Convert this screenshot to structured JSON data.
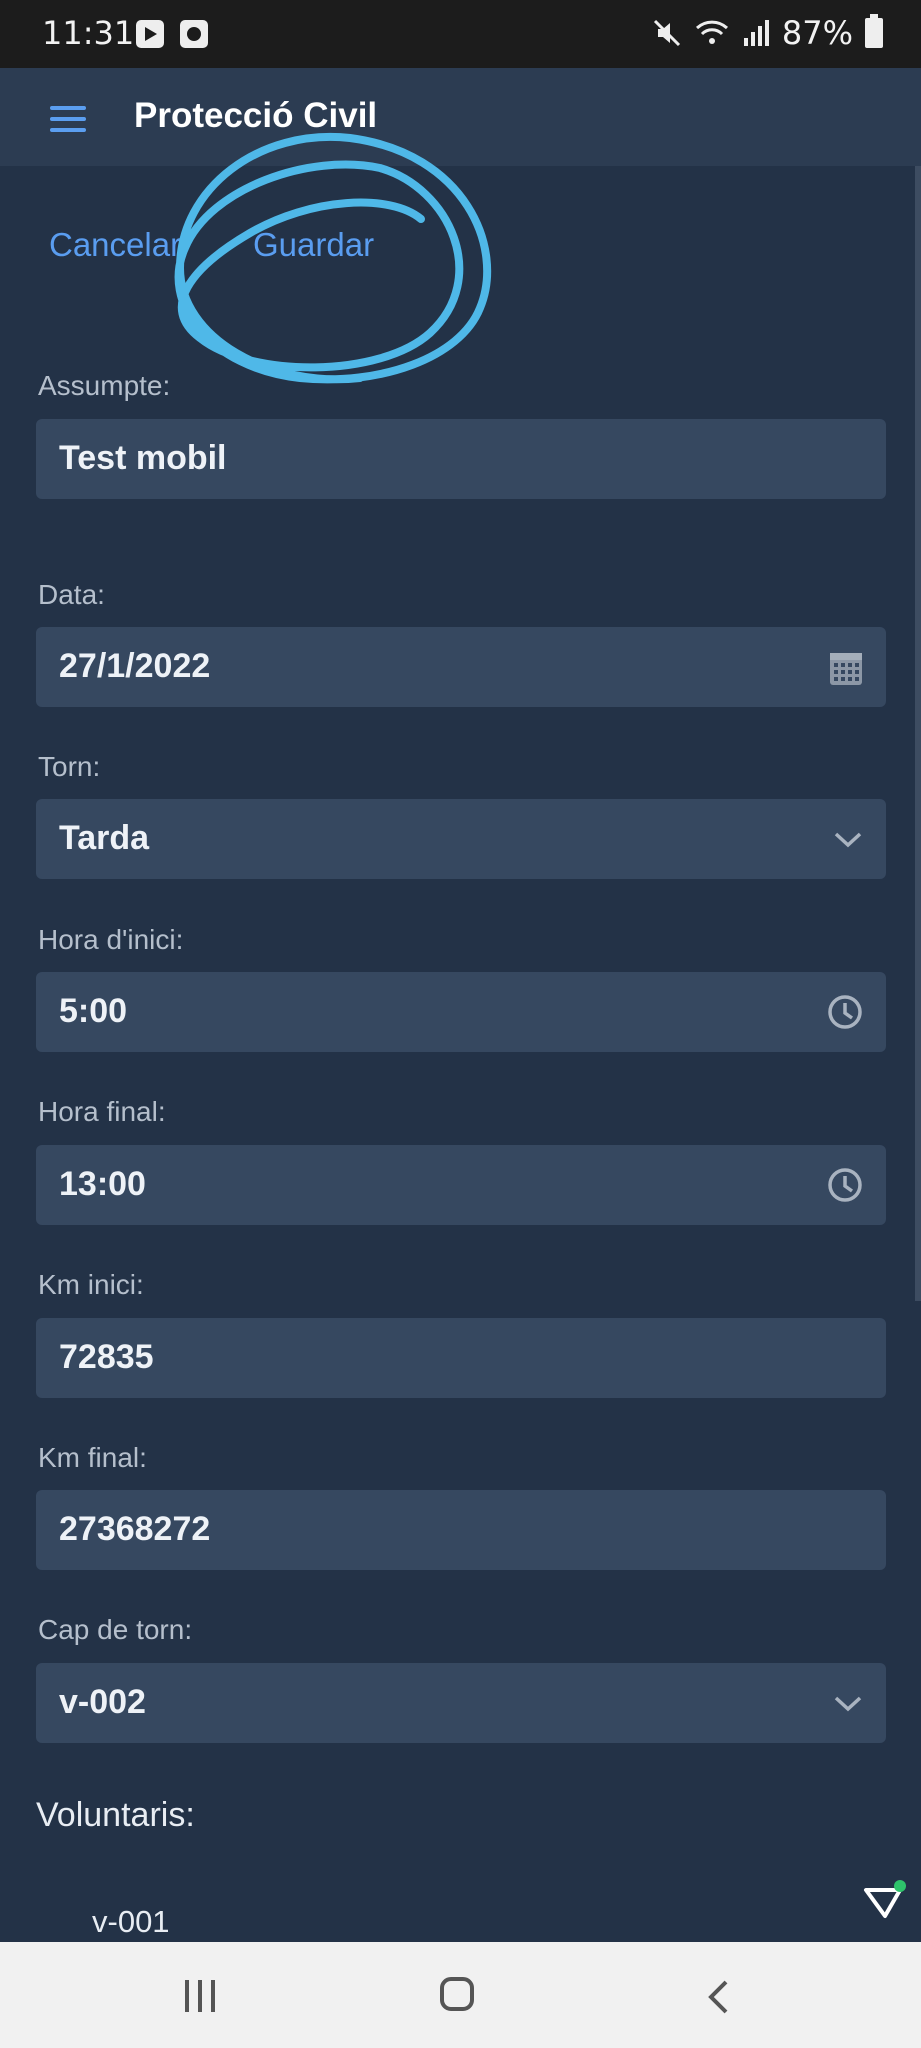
{
  "status": {
    "time": "11:31",
    "battery": "87%"
  },
  "app": {
    "title": "Protecció Civil"
  },
  "actions": {
    "cancel": "Cancelar",
    "save": "Guardar"
  },
  "form": {
    "subject_label": "Assumpte:",
    "subject_value": "Test mobil",
    "date_label": "Data:",
    "date_value": "27/1/2022",
    "shift_label": "Torn:",
    "shift_value": "Tarda",
    "start_label": "Hora d'inici:",
    "start_value": "5:00",
    "end_label": "Hora final:",
    "end_value": "13:00",
    "km_start_label": "Km inici:",
    "km_start_value": "72835",
    "km_end_label": "Km final:",
    "km_end_value": "27368272",
    "lead_label": "Cap de torn:",
    "lead_value": "v-002"
  },
  "volunteers": {
    "title": "Voluntaris:",
    "items": [
      "v-001"
    ]
  },
  "colors": {
    "accent": "#5a9df0",
    "background": "#233247",
    "field": "#364860",
    "annotation": "#4fb8e8"
  },
  "icons": [
    "menu-icon",
    "calendar-icon",
    "chevron-down-icon",
    "clock-icon",
    "recent-apps-icon",
    "home-icon",
    "back-icon"
  ]
}
